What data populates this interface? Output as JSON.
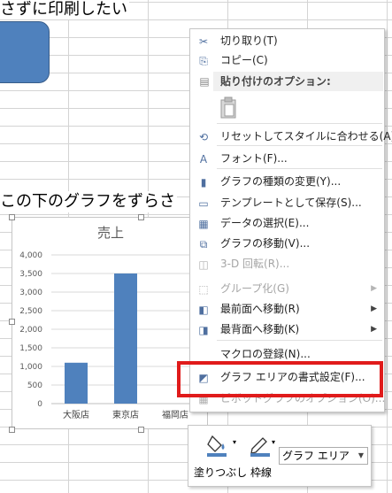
{
  "sheet": {
    "top_text": "さずに印刷したい",
    "mid_text": "この下のグラフをずらさ"
  },
  "chart_data": {
    "type": "bar",
    "title": "売上",
    "categories": [
      "大阪店",
      "東京店",
      "福岡店"
    ],
    "values": [
      1100,
      3500,
      0
    ],
    "yticks": [
      "0",
      "500",
      "1,000",
      "1,500",
      "2,000",
      "2,500",
      "3,000",
      "3,500",
      "4,000"
    ],
    "ylim": [
      0,
      4000
    ],
    "color": "#4f81bd",
    "grid": true
  },
  "context_menu": {
    "items": [
      {
        "icon": "scissors-icon",
        "glyph": "✂",
        "label": "切り取り(T)",
        "disabled": false
      },
      {
        "icon": "copy-icon",
        "glyph": "⎘",
        "label": "コピー(C)",
        "disabled": false
      },
      {
        "icon": "paste-icon",
        "glyph": "▤",
        "label": "貼り付けのオプション:",
        "header": true
      },
      {
        "icon": "reset-style-icon",
        "glyph": "⟲",
        "label": "リセットしてスタイルに合わせる(A)",
        "disabled": false
      },
      {
        "icon": "font-icon",
        "glyph": "A",
        "label": "フォント(F)...",
        "disabled": false
      },
      {
        "icon": "chart-type-icon",
        "glyph": "▮",
        "label": "グラフの種類の変更(Y)...",
        "disabled": false
      },
      {
        "icon": "template-icon",
        "glyph": "▭",
        "label": "テンプレートとして保存(S)...",
        "disabled": false
      },
      {
        "icon": "select-data-icon",
        "glyph": "▦",
        "label": "データの選択(E)...",
        "disabled": false
      },
      {
        "icon": "move-chart-icon",
        "glyph": "⧉",
        "label": "グラフの移動(V)...",
        "disabled": false
      },
      {
        "icon": "rotate-3d-icon",
        "glyph": "◫",
        "label": "3-D 回転(R)...",
        "disabled": true
      },
      {
        "icon": "group-icon",
        "glyph": "⬚",
        "label": "グループ化(G)",
        "disabled": true,
        "submenu": true
      },
      {
        "icon": "bring-front-icon",
        "glyph": "◧",
        "label": "最前面へ移動(R)",
        "disabled": false,
        "submenu": true
      },
      {
        "icon": "send-back-icon",
        "glyph": "◨",
        "label": "最背面へ移動(K)",
        "disabled": false,
        "submenu": true
      },
      {
        "icon": "",
        "glyph": "",
        "label": "マクロの登録(N)...",
        "disabled": false
      },
      {
        "icon": "format-chart-area-icon",
        "glyph": "◩",
        "label": "グラフ エリアの書式設定(F)...",
        "disabled": false
      },
      {
        "icon": "pivot-options-icon",
        "glyph": "▦",
        "label": "ピボットグラフのオプション(O)...",
        "disabled": true
      }
    ]
  },
  "mini_toolbar": {
    "fill_label": "塗りつぶし",
    "outline_label": "枠線",
    "element_select": "グラフ エリア"
  },
  "colors": {
    "highlight": "#e01b1b",
    "bar": "#4f81bd"
  }
}
